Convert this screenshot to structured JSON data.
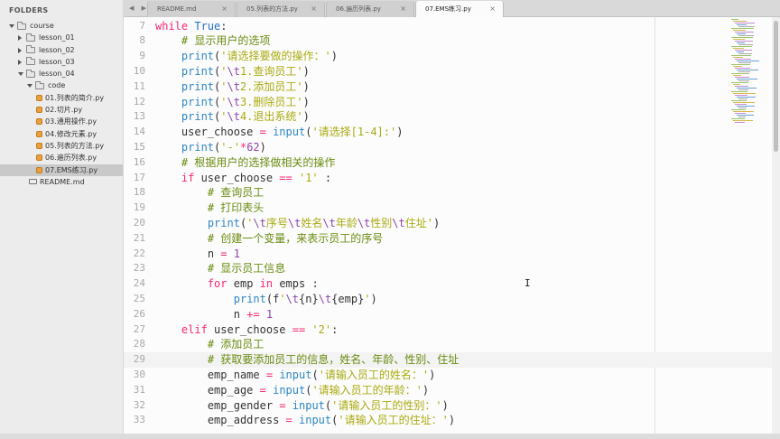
{
  "sidebar": {
    "title": "FOLDERS",
    "items": [
      {
        "label": "course",
        "type": "folder",
        "state": "open",
        "depth": 0
      },
      {
        "label": "lesson_01",
        "type": "folder",
        "state": "closed",
        "depth": 1
      },
      {
        "label": "lesson_02",
        "type": "folder",
        "state": "closed",
        "depth": 1
      },
      {
        "label": "lesson_03",
        "type": "folder",
        "state": "closed",
        "depth": 1
      },
      {
        "label": "lesson_04",
        "type": "folder",
        "state": "open",
        "depth": 1
      },
      {
        "label": "code",
        "type": "folder",
        "state": "open",
        "depth": 2
      },
      {
        "label": "01.列表的简介.py",
        "type": "py",
        "depth": 3
      },
      {
        "label": "02.切片.py",
        "type": "py",
        "depth": 3
      },
      {
        "label": "03.通用操作.py",
        "type": "py",
        "depth": 3
      },
      {
        "label": "04.修改元素.py",
        "type": "py",
        "depth": 3
      },
      {
        "label": "05.列表的方法.py",
        "type": "py",
        "depth": 3
      },
      {
        "label": "06.遍历列表.py",
        "type": "py",
        "depth": 3
      },
      {
        "label": "07.EMS练习.py",
        "type": "py",
        "depth": 3,
        "selected": true
      },
      {
        "label": "README.md",
        "type": "md",
        "depth": 2
      }
    ]
  },
  "tabs": {
    "nav": "◀ ▶",
    "close_glyph": "×",
    "items": [
      {
        "label": "README.md",
        "active": false
      },
      {
        "label": "05.列表的方法.py",
        "active": false
      },
      {
        "label": "06.遍历列表.py",
        "active": false
      },
      {
        "label": "07.EMS练习.py",
        "active": true
      }
    ]
  },
  "editor": {
    "current_line": 29,
    "lines": [
      {
        "n": "7",
        "indent": 0,
        "tokens": [
          [
            "k",
            "while"
          ],
          [
            "t",
            " "
          ],
          [
            "kp",
            "True"
          ],
          [
            "t",
            ":"
          ]
        ]
      },
      {
        "n": "8",
        "indent": 4,
        "tokens": [
          [
            "c",
            "# 显示用户的选项"
          ]
        ]
      },
      {
        "n": "9",
        "indent": 4,
        "tokens": [
          [
            "f",
            "print"
          ],
          [
            "t",
            "("
          ],
          [
            "s",
            "'请选择要做的操作：'"
          ],
          [
            "t",
            ")"
          ]
        ]
      },
      {
        "n": "10",
        "indent": 4,
        "tokens": [
          [
            "f",
            "print"
          ],
          [
            "t",
            "("
          ],
          [
            "s",
            "'"
          ],
          [
            "n",
            "\\t"
          ],
          [
            "s",
            "1.查询员工'"
          ],
          [
            "t",
            ")"
          ]
        ]
      },
      {
        "n": "11",
        "indent": 4,
        "tokens": [
          [
            "f",
            "print"
          ],
          [
            "t",
            "("
          ],
          [
            "s",
            "'"
          ],
          [
            "n",
            "\\t"
          ],
          [
            "s",
            "2.添加员工'"
          ],
          [
            "t",
            ")"
          ]
        ]
      },
      {
        "n": "12",
        "indent": 4,
        "tokens": [
          [
            "f",
            "print"
          ],
          [
            "t",
            "("
          ],
          [
            "s",
            "'"
          ],
          [
            "n",
            "\\t"
          ],
          [
            "s",
            "3.删除员工'"
          ],
          [
            "t",
            ")"
          ]
        ]
      },
      {
        "n": "13",
        "indent": 4,
        "tokens": [
          [
            "f",
            "print"
          ],
          [
            "t",
            "("
          ],
          [
            "s",
            "'"
          ],
          [
            "n",
            "\\t"
          ],
          [
            "s",
            "4.退出系统'"
          ],
          [
            "t",
            ")"
          ]
        ]
      },
      {
        "n": "14",
        "indent": 4,
        "tokens": [
          [
            "t",
            "user_choose "
          ],
          [
            "o",
            "="
          ],
          [
            "t",
            " "
          ],
          [
            "f",
            "input"
          ],
          [
            "t",
            "("
          ],
          [
            "s",
            "'请选择[1-4]:'"
          ],
          [
            "t",
            ")"
          ]
        ]
      },
      {
        "n": "15",
        "indent": 4,
        "tokens": [
          [
            "f",
            "print"
          ],
          [
            "t",
            "("
          ],
          [
            "s",
            "'-'"
          ],
          [
            "o",
            "*"
          ],
          [
            "n",
            "62"
          ],
          [
            "t",
            ")"
          ]
        ]
      },
      {
        "n": "16",
        "indent": 4,
        "tokens": [
          [
            "c",
            "# 根据用户的选择做相关的操作"
          ]
        ]
      },
      {
        "n": "17",
        "indent": 4,
        "tokens": [
          [
            "k",
            "if"
          ],
          [
            "t",
            " user_choose "
          ],
          [
            "o",
            "=="
          ],
          [
            "t",
            " "
          ],
          [
            "s",
            "'1'"
          ],
          [
            "t",
            " :"
          ]
        ]
      },
      {
        "n": "18",
        "indent": 8,
        "tokens": [
          [
            "c",
            "# 查询员工"
          ]
        ]
      },
      {
        "n": "19",
        "indent": 8,
        "tokens": [
          [
            "c",
            "# 打印表头"
          ]
        ]
      },
      {
        "n": "20",
        "indent": 8,
        "tokens": [
          [
            "f",
            "print"
          ],
          [
            "t",
            "("
          ],
          [
            "s",
            "'"
          ],
          [
            "n",
            "\\t"
          ],
          [
            "s",
            "序号"
          ],
          [
            "n",
            "\\t"
          ],
          [
            "s",
            "姓名"
          ],
          [
            "n",
            "\\t"
          ],
          [
            "s",
            "年龄"
          ],
          [
            "n",
            "\\t"
          ],
          [
            "s",
            "性别"
          ],
          [
            "n",
            "\\t"
          ],
          [
            "s",
            "住址'"
          ],
          [
            "t",
            ")"
          ]
        ]
      },
      {
        "n": "21",
        "indent": 8,
        "tokens": [
          [
            "c",
            "# 创建一个变量，来表示员工的序号"
          ]
        ]
      },
      {
        "n": "22",
        "indent": 8,
        "tokens": [
          [
            "t",
            "n "
          ],
          [
            "o",
            "="
          ],
          [
            "t",
            " "
          ],
          [
            "n",
            "1"
          ]
        ]
      },
      {
        "n": "23",
        "indent": 8,
        "tokens": [
          [
            "c",
            "# 显示员工信息"
          ]
        ]
      },
      {
        "n": "24",
        "indent": 8,
        "tokens": [
          [
            "k",
            "for"
          ],
          [
            "t",
            " emp "
          ],
          [
            "k",
            "in"
          ],
          [
            "t",
            " emps :"
          ]
        ]
      },
      {
        "n": "25",
        "indent": 12,
        "tokens": [
          [
            "f",
            "print"
          ],
          [
            "t",
            "("
          ],
          [
            "t",
            "f"
          ],
          [
            "s",
            "'"
          ],
          [
            "n",
            "\\t"
          ],
          [
            "t",
            "{n}"
          ],
          [
            "n",
            "\\t"
          ],
          [
            "t",
            "{emp}"
          ],
          [
            "s",
            "'"
          ],
          [
            "t",
            ")"
          ]
        ]
      },
      {
        "n": "26",
        "indent": 12,
        "tokens": [
          [
            "t",
            "n "
          ],
          [
            "o",
            "+="
          ],
          [
            "t",
            " "
          ],
          [
            "n",
            "1"
          ]
        ]
      },
      {
        "n": "27",
        "indent": 4,
        "tokens": [
          [
            "k",
            "elif"
          ],
          [
            "t",
            " user_choose "
          ],
          [
            "o",
            "=="
          ],
          [
            "t",
            " "
          ],
          [
            "s",
            "'2'"
          ],
          [
            "t",
            ":"
          ]
        ]
      },
      {
        "n": "28",
        "indent": 8,
        "tokens": [
          [
            "c",
            "# 添加员工"
          ]
        ]
      },
      {
        "n": "29",
        "indent": 8,
        "tokens": [
          [
            "c",
            "# 获取要添加员工的信息，姓名、年龄、性别、住址"
          ]
        ]
      },
      {
        "n": "30",
        "indent": 8,
        "tokens": [
          [
            "t",
            "emp_name "
          ],
          [
            "o",
            "="
          ],
          [
            "t",
            " "
          ],
          [
            "f",
            "input"
          ],
          [
            "t",
            "("
          ],
          [
            "s",
            "'请输入员工的姓名：'"
          ],
          [
            "t",
            ")"
          ]
        ]
      },
      {
        "n": "31",
        "indent": 8,
        "tokens": [
          [
            "t",
            "emp_age "
          ],
          [
            "o",
            "="
          ],
          [
            "t",
            " "
          ],
          [
            "f",
            "input"
          ],
          [
            "t",
            "("
          ],
          [
            "s",
            "'请输入员工的年龄：'"
          ],
          [
            "t",
            ")"
          ]
        ]
      },
      {
        "n": "32",
        "indent": 8,
        "tokens": [
          [
            "t",
            "emp_gender "
          ],
          [
            "o",
            "="
          ],
          [
            "t",
            " "
          ],
          [
            "f",
            "input"
          ],
          [
            "t",
            "("
          ],
          [
            "s",
            "'请输入员工的性别：'"
          ],
          [
            "t",
            ")"
          ]
        ]
      },
      {
        "n": "33",
        "indent": 8,
        "tokens": [
          [
            "t",
            "emp_address "
          ],
          [
            "o",
            "="
          ],
          [
            "t",
            " "
          ],
          [
            "f",
            "input"
          ],
          [
            "t",
            "("
          ],
          [
            "s",
            "'请输入员工的住址：'"
          ],
          [
            "t",
            ")"
          ]
        ]
      }
    ]
  },
  "colors": {
    "keyword": "#f92672",
    "string": "#aaaa10",
    "comment": "#6a8c10",
    "number": "#8e44ad",
    "builtin": "#2d86c4",
    "selected_row": "#c9c9c9"
  },
  "icons": {
    "folder": "folder-icon",
    "python_file": "python-file-icon",
    "markdown_file": "markdown-file-icon"
  }
}
